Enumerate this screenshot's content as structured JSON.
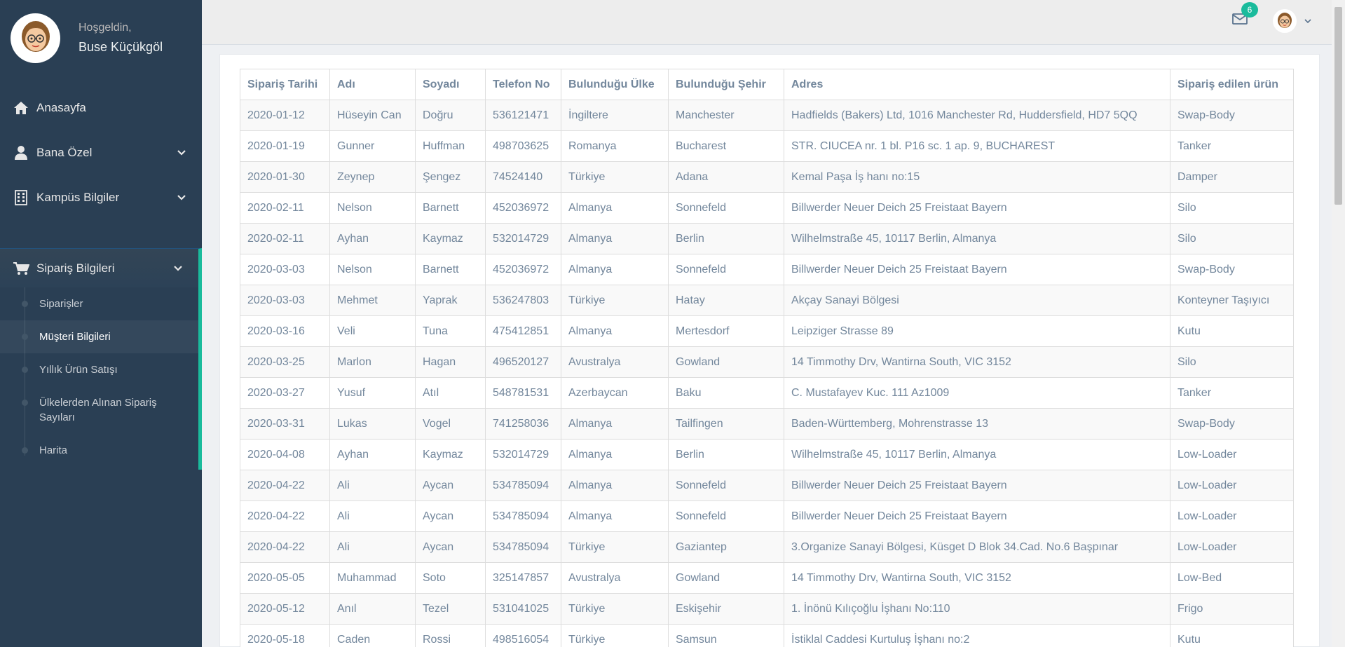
{
  "profile": {
    "welcome": "Hoşgeldin,",
    "name": "Buse Küçükgöl"
  },
  "menu": {
    "home": "Anasayfa",
    "personal": "Bana Özel",
    "campus": "Kampüs Bilgiler",
    "orders": "Sipariş Bilgileri",
    "sub": [
      "Siparişler",
      "Müşteri Bilgileri",
      "Yıllık Ürün Satışı",
      "Ülkelerden Alınan Sipariş Sayıları",
      "Harita"
    ]
  },
  "topnav": {
    "mail_count": "6"
  },
  "table": {
    "headers": [
      "Sipariş Tarihi",
      "Adı",
      "Soyadı",
      "Telefon No",
      "Bulunduğu Ülke",
      "Bulunduğu Şehir",
      "Adres",
      "Sipariş edilen ürün"
    ],
    "rows": [
      [
        "2020-01-12",
        "Hüseyin Can",
        "Doğru",
        "536121471",
        "İngiltere",
        "Manchester",
        "Hadfields (Bakers) Ltd, 1016 Manchester Rd, Huddersfield, HD7 5QQ",
        "Swap-Body"
      ],
      [
        "2020-01-19",
        "Gunner",
        "Huffman",
        "498703625",
        "Romanya",
        "Bucharest",
        "STR. CIUCEA nr. 1 bl. P16 sc. 1 ap. 9, BUCHAREST",
        "Tanker"
      ],
      [
        "2020-01-30",
        "Zeynep",
        "Şengez",
        "74524140",
        "Türkiye",
        "Adana",
        "Kemal Paşa İş hanı no:15",
        "Damper"
      ],
      [
        "2020-02-11",
        "Nelson",
        "Barnett",
        "452036972",
        "Almanya",
        "Sonnefeld",
        "Billwerder Neuer Deich 25 Freistaat Bayern",
        "Silo"
      ],
      [
        "2020-02-11",
        "Ayhan",
        "Kaymaz",
        "532014729",
        "Almanya",
        "Berlin",
        "Wilhelmstraße 45, 10117 Berlin, Almanya",
        "Silo"
      ],
      [
        "2020-03-03",
        "Nelson",
        "Barnett",
        "452036972",
        "Almanya",
        "Sonnefeld",
        "Billwerder Neuer Deich 25 Freistaat Bayern",
        "Swap-Body"
      ],
      [
        "2020-03-03",
        "Mehmet",
        "Yaprak",
        "536247803",
        "Türkiye",
        "Hatay",
        "Akçay Sanayi Bölgesi",
        "Konteyner Taşıyıcı"
      ],
      [
        "2020-03-16",
        "Veli",
        "Tuna",
        "475412851",
        "Almanya",
        "Mertesdorf",
        "Leipziger Strasse 89",
        "Kutu"
      ],
      [
        "2020-03-25",
        "Marlon",
        "Hagan",
        "496520127",
        "Avustralya",
        "Gowland",
        "14 Timmothy Drv, Wantirna South, VIC 3152",
        "Silo"
      ],
      [
        "2020-03-27",
        "Yusuf",
        "Atıl",
        "548781531",
        "Azerbaycan",
        "Baku",
        "C. Mustafayev Kuc. 111 Az1009",
        "Tanker"
      ],
      [
        "2020-03-31",
        "Lukas",
        "Vogel",
        "741258036",
        "Almanya",
        "Tailfingen",
        "Baden-Württemberg, Mohrenstrasse 13",
        "Swap-Body"
      ],
      [
        "2020-04-08",
        "Ayhan",
        "Kaymaz",
        "532014729",
        "Almanya",
        "Berlin",
        "Wilhelmstraße 45, 10117 Berlin, Almanya",
        "Low-Loader"
      ],
      [
        "2020-04-22",
        "Ali",
        "Aycan",
        "534785094",
        "Almanya",
        "Sonnefeld",
        "Billwerder Neuer Deich 25 Freistaat Bayern",
        "Low-Loader"
      ],
      [
        "2020-04-22",
        "Ali",
        "Aycan",
        "534785094",
        "Almanya",
        "Sonnefeld",
        "Billwerder Neuer Deich 25 Freistaat Bayern",
        "Low-Loader"
      ],
      [
        "2020-04-22",
        "Ali",
        "Aycan",
        "534785094",
        "Türkiye",
        "Gaziantep",
        "3.Organize Sanayi Bölgesi, Küsget D Blok 34.Cad. No.6 Başpınar",
        "Low-Loader"
      ],
      [
        "2020-05-05",
        "Muhammad",
        "Soto",
        "325147857",
        "Avustralya",
        "Gowland",
        "14 Timmothy Drv, Wantirna South, VIC 3152",
        "Low-Bed"
      ],
      [
        "2020-05-12",
        "Anıl",
        "Tezel",
        "531041025",
        "Türkiye",
        "Eskişehir",
        "1. İnönü Kılıçoğlu İşhanı No:110",
        "Frigo"
      ],
      [
        "2020-05-18",
        "Caden",
        "Rossi",
        "498516054",
        "Türkiye",
        "Samsun",
        "İstiklal Caddesi Kurtuluş İşhanı no:2",
        "Kutu"
      ]
    ]
  }
}
